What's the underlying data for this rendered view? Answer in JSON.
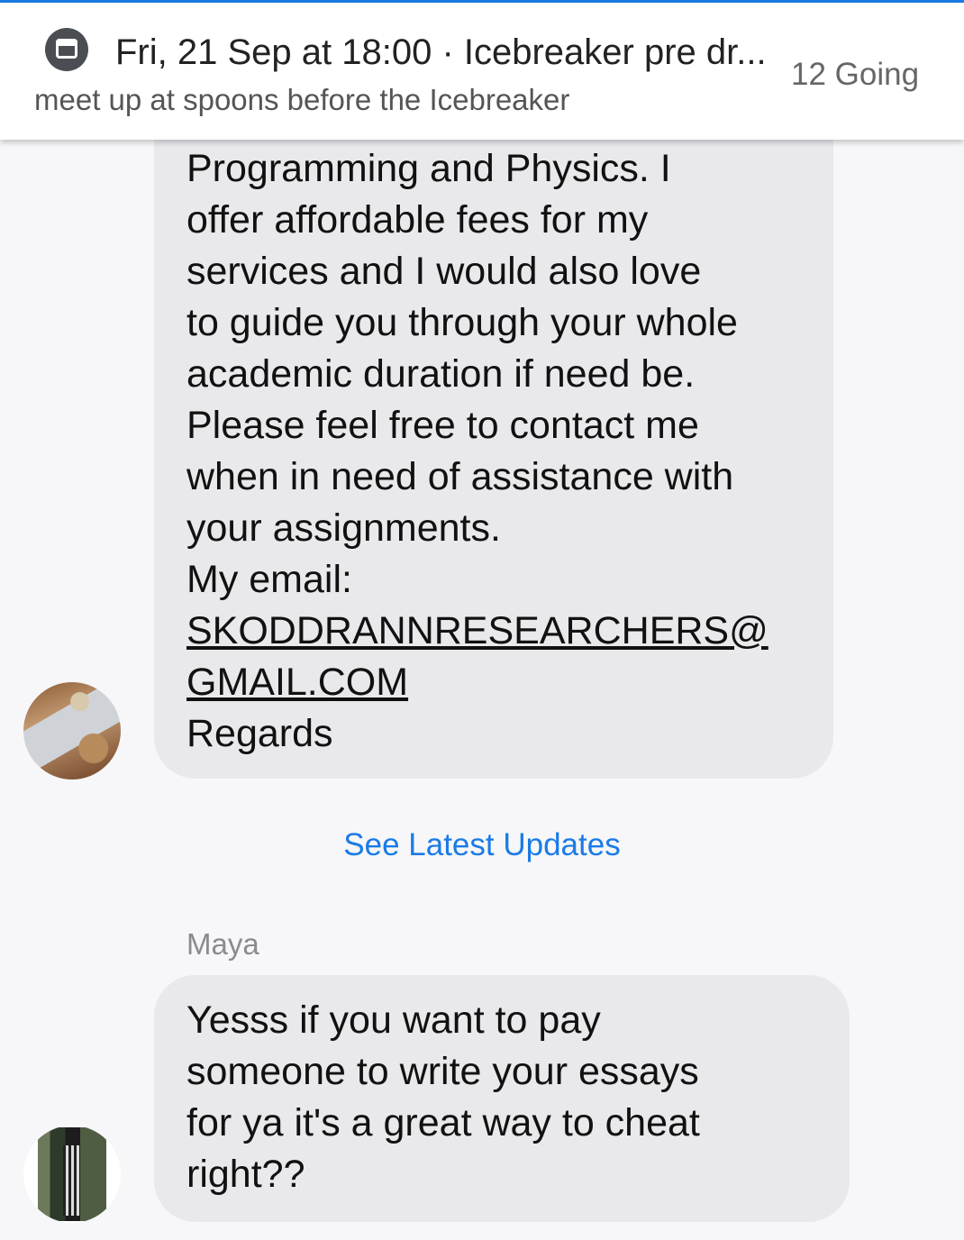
{
  "event": {
    "title": "Fri, 21 Sep at 18:00 · Icebreaker pre dr...",
    "description": "meet up at spoons before the Icebreaker",
    "going": "12 Going",
    "icon": "calendar-icon",
    "accent_color": "#1a7be6"
  },
  "messages": [
    {
      "lines": [
        "Programming and Physics. I",
        "offer affordable fees for my",
        "services and I would also love",
        "to guide you through your whole",
        "academic duration if need be.",
        "Please feel free to contact me",
        "when in need of assistance with",
        "your assignments.",
        "My email:"
      ],
      "email_lines": [
        "SKODDRANNRESEARCHERS@",
        "GMAIL.COM"
      ],
      "closing": "Regards"
    },
    {
      "sender": "Maya",
      "lines": [
        "Yesss if you want to pay",
        "someone to write your essays",
        "for ya it's a great way to cheat",
        "right??"
      ]
    }
  ],
  "see_latest_updates": "See Latest Updates"
}
